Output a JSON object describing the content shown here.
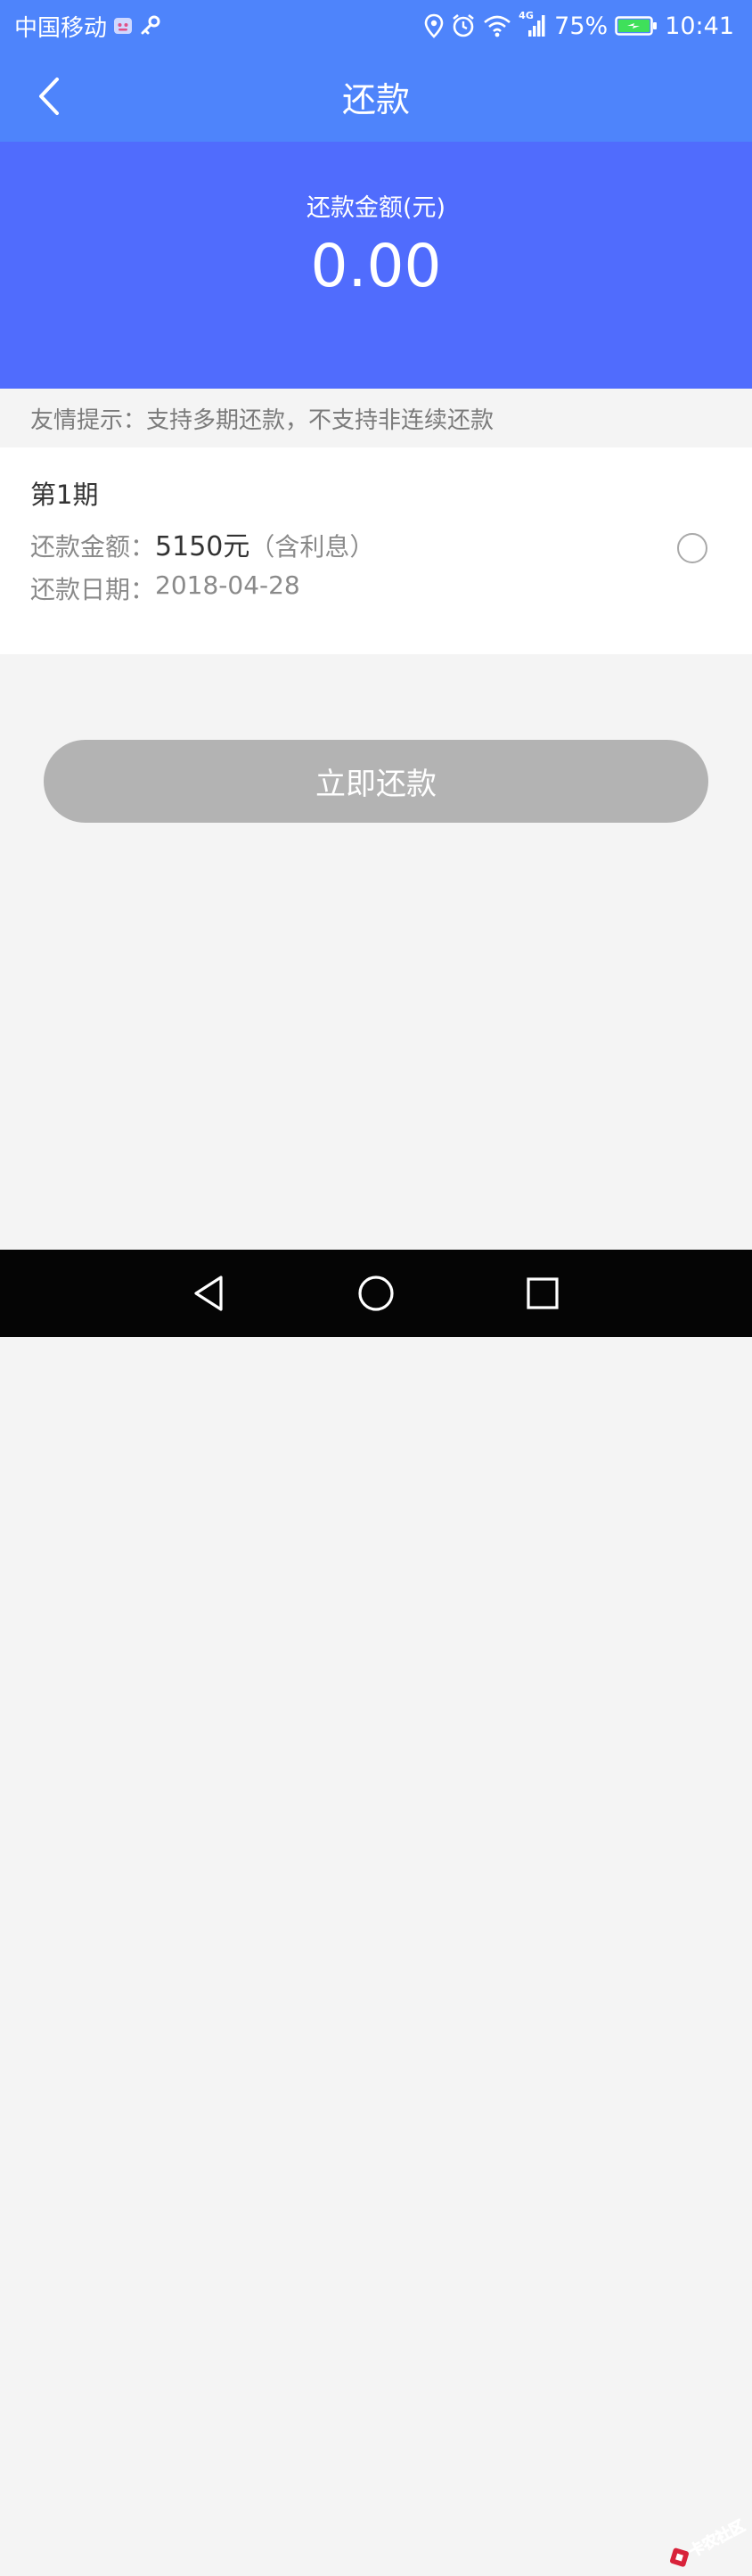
{
  "status_bar": {
    "carrier": "中国移动",
    "network": "4G",
    "battery": "75%",
    "time": "10:41"
  },
  "header": {
    "title": "还款"
  },
  "summary": {
    "label": "还款金额(元)",
    "amount": "0.00"
  },
  "tip": {
    "text": "友情提示：支持多期还款，不支持非连续还款"
  },
  "installment": {
    "period": "第1期",
    "amount_label": "还款金额：",
    "amount_value": "5150元",
    "amount_note": "（含利息）",
    "date_label": "还款日期：",
    "date_value": "2018-04-28",
    "selected": false
  },
  "actions": {
    "pay_now": "立即还款"
  },
  "watermark": {
    "text": "卡农社区"
  },
  "colors": {
    "nav_blue": "#4e84fb",
    "panel_blue": "#506cfd",
    "button_disabled": "#b3b3b3",
    "page_bg": "#f4f4f4"
  }
}
